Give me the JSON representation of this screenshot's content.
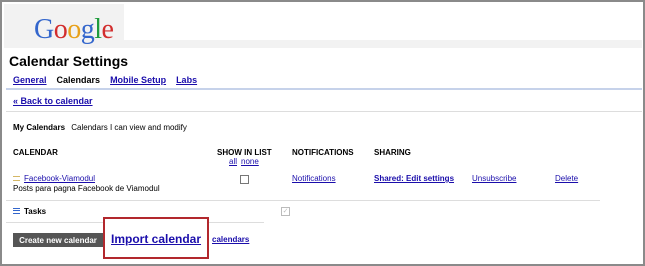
{
  "brand": {
    "logo_letters": [
      "G",
      "o",
      "o",
      "g",
      "l",
      "e"
    ],
    "logo_colors": [
      "#3366cc",
      "#d22d2d",
      "#e8a11a",
      "#3366cc",
      "#1e9b3c",
      "#d22d2d"
    ]
  },
  "page_title": "Calendar Settings",
  "tabs": [
    {
      "label": "General",
      "active": false
    },
    {
      "label": "Calendars",
      "active": true
    },
    {
      "label": "Mobile Setup",
      "active": false
    },
    {
      "label": "Labs",
      "active": false
    }
  ],
  "back_link": "« Back to calendar",
  "my_calendars": {
    "title": "My Calendars",
    "subtitle": "Calendars I can view and modify"
  },
  "columns": {
    "calendar": "CALENDAR",
    "show_in_list": "SHOW IN LIST",
    "all": "all",
    "none": "none",
    "notifications": "NOTIFICATIONS",
    "sharing": "SHARING"
  },
  "calendar_row": {
    "name": "Facebook-Viamodul",
    "description": "Posts para pagna Facebook de Viamodul",
    "notifications": "Notifications",
    "sharing": "Shared: Edit settings",
    "unsubscribe": "Unsubscribe",
    "delete": "Delete",
    "checked": false
  },
  "tasks": {
    "label": "Tasks"
  },
  "actions": {
    "create": "Create new calendar",
    "import": "Import calendar",
    "partial": "calendars"
  }
}
